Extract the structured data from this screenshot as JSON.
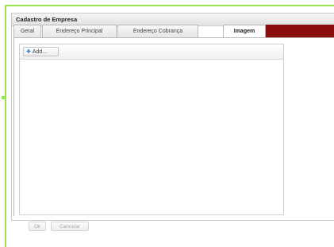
{
  "window": {
    "title": "Cadastro de Empresa"
  },
  "tabs": [
    {
      "label": "Geral"
    },
    {
      "label": "Endereço Principal"
    },
    {
      "label": "Endereço Cobrança"
    },
    {
      "label": "Imagem"
    }
  ],
  "active_tab": "Imagem",
  "images_panel": {
    "add_label": "Add..."
  },
  "footer": {
    "ok_label": "Ok",
    "cancel_label": "Cancelar"
  },
  "colors": {
    "frame_border": "#9be34b",
    "tab_accent": "#8b0c0c",
    "add_icon": "#2b7dd1"
  }
}
